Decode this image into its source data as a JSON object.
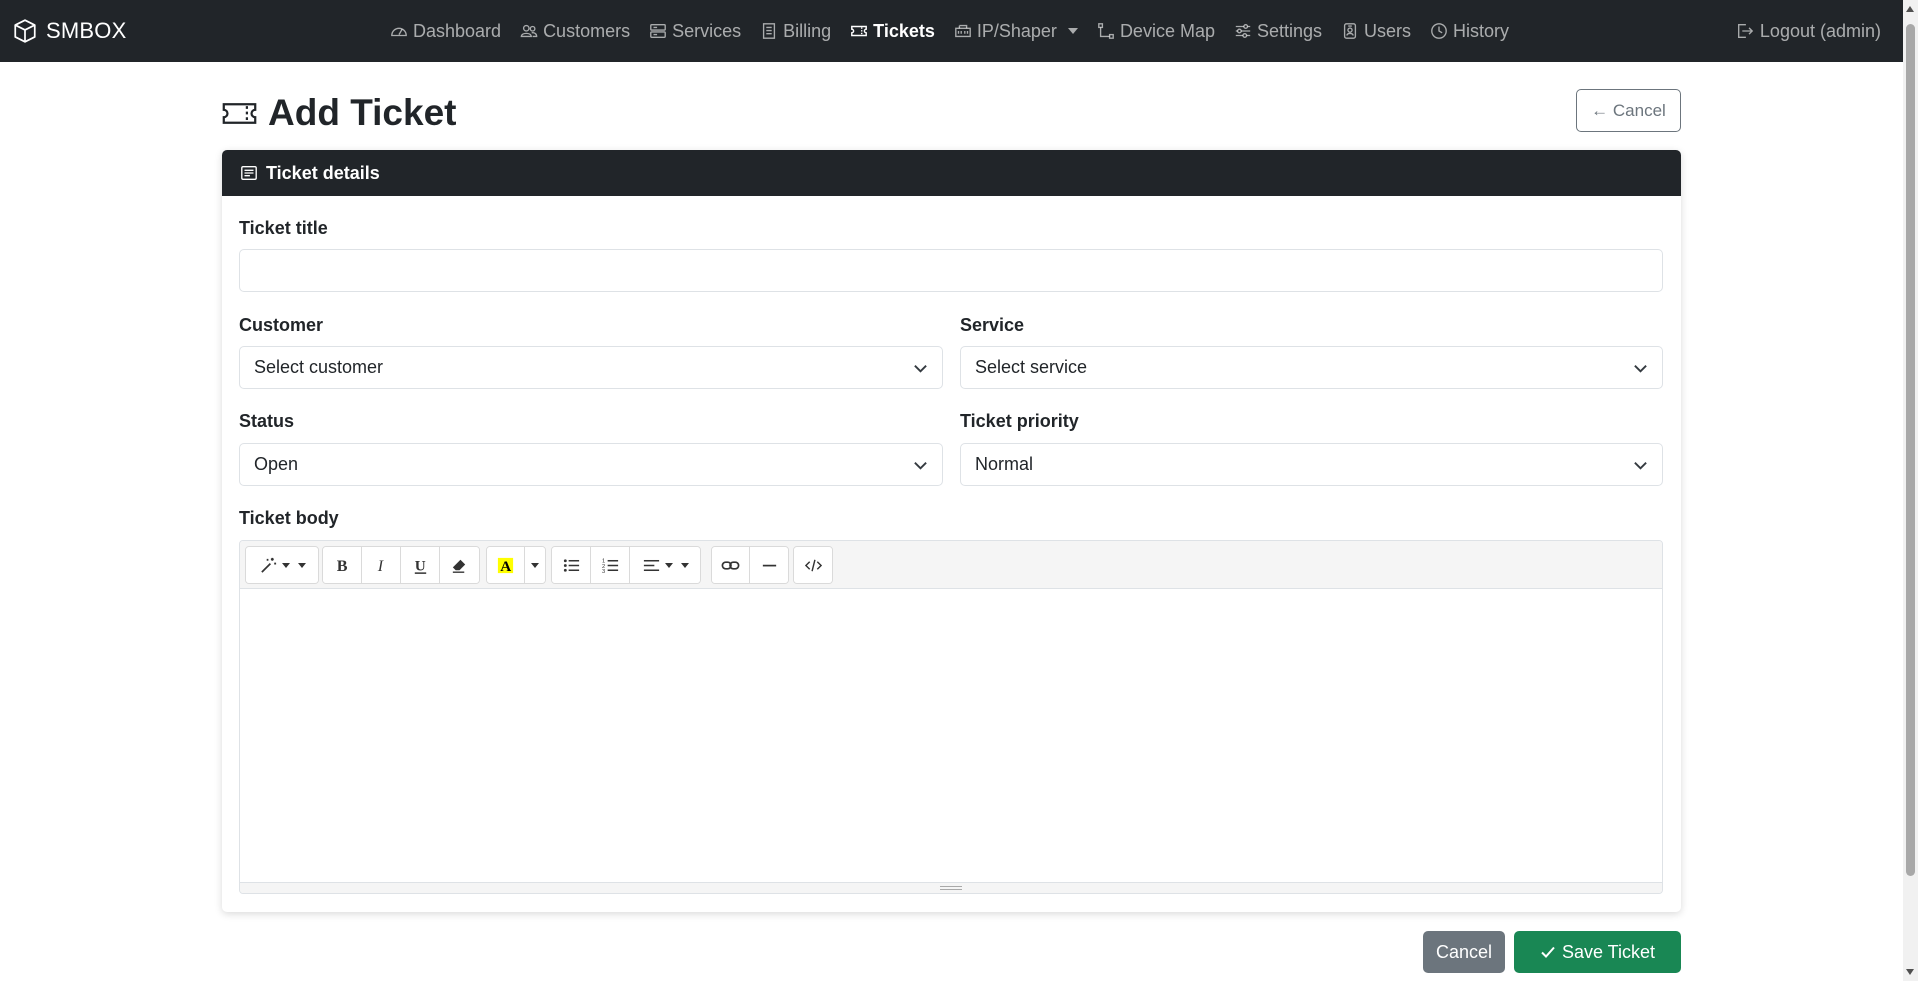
{
  "navbar": {
    "brand": "SMBOX",
    "items": [
      {
        "label": "Dashboard",
        "icon": "speedometer-icon"
      },
      {
        "label": "Customers",
        "icon": "people-icon"
      },
      {
        "label": "Services",
        "icon": "server-icon"
      },
      {
        "label": "Billing",
        "icon": "receipt-icon"
      },
      {
        "label": "Tickets",
        "icon": "ticket-icon",
        "active": true
      },
      {
        "label": "IP/Shaper",
        "icon": "ethernet-icon",
        "dropdown": true
      },
      {
        "label": "Device Map",
        "icon": "diagram-icon"
      },
      {
        "label": "Settings",
        "icon": "sliders-icon"
      },
      {
        "label": "Users",
        "icon": "person-badge-icon"
      },
      {
        "label": "History",
        "icon": "clock-icon"
      }
    ],
    "logout": "Logout (admin)"
  },
  "page": {
    "title": "Add Ticket",
    "cancel_top": "← Cancel"
  },
  "card": {
    "header": "Ticket details",
    "fields": {
      "title_label": "Ticket title",
      "title_value": "",
      "customer_label": "Customer",
      "customer_value": "Select customer",
      "service_label": "Service",
      "service_value": "Select service",
      "status_label": "Status",
      "status_value": "Open",
      "priority_label": "Ticket priority",
      "priority_value": "Normal",
      "body_label": "Ticket body"
    }
  },
  "footer": {
    "cancel": "Cancel",
    "save": "Save Ticket"
  },
  "colors": {
    "navbar_bg": "#212529",
    "save_green": "#198754",
    "cancel_gray": "#6c757d",
    "highlight_yellow": "#ffff00"
  }
}
